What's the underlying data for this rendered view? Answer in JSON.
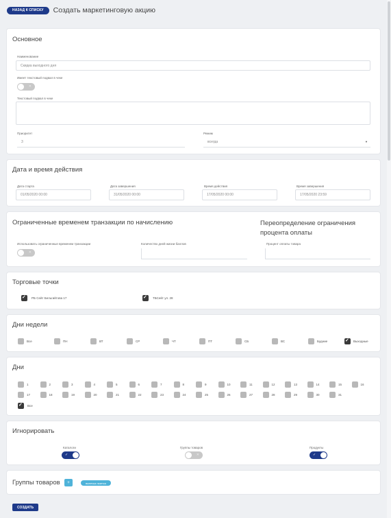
{
  "header": {
    "back_label": "НАЗАД К СПИСКУ",
    "title": "Создать маркетинговую акцию"
  },
  "basic": {
    "title": "Основное",
    "name_label": "Наименование",
    "name_placeholder": "Скидка выходного дня",
    "has_text_label": "Имеет текстовый подвал в чеке",
    "has_text_on": false,
    "footer_label": "Текстовый подвал в чеке",
    "footer_value": "",
    "priority_label": "Приоритет",
    "priority_value": "3",
    "mode_label": "Режим",
    "mode_value": "всегда"
  },
  "datetime": {
    "title": "Дата и время действия",
    "fields": [
      {
        "label": "Дата старта",
        "value": "01/05/2020 00:00"
      },
      {
        "label": "Дата завершения",
        "value": "31/05/2020 00:00"
      },
      {
        "label": "Время действия",
        "value": "17/05/2020 00:00"
      },
      {
        "label": "Время завершения",
        "value": "17/05/2020 23:59"
      }
    ]
  },
  "limits": {
    "title": "Ограниченные временем транзакции по начислению",
    "use_label": "Использовать ограниченные временем транзакции",
    "use_on": false,
    "days_label": "Количество дней жизни баллов",
    "days_value": "",
    "override_title": "Переопределение ограничения процента оплаты",
    "percent_label": "Процент оплаты товара",
    "percent_value": ""
  },
  "stores": {
    "title": "Торговые точки",
    "items": [
      {
        "label": "РБ Сейт Бельгийтова 17",
        "checked": true
      },
      {
        "label": "ТБСейт ул. 28",
        "checked": true
      }
    ]
  },
  "weekdays": {
    "title": "Дни недели",
    "items": [
      {
        "label": "Все",
        "checked": false
      },
      {
        "label": "ПН",
        "checked": false
      },
      {
        "label": "ВТ",
        "checked": false
      },
      {
        "label": "СР",
        "checked": false
      },
      {
        "label": "ЧТ",
        "checked": false
      },
      {
        "label": "ПТ",
        "checked": false
      },
      {
        "label": "СБ",
        "checked": false
      },
      {
        "label": "ВС",
        "checked": false
      },
      {
        "label": "Будние",
        "checked": false
      },
      {
        "label": "Выходные",
        "checked": true
      }
    ]
  },
  "days": {
    "title": "Дни",
    "numbers": [
      "1",
      "2",
      "3",
      "4",
      "5",
      "6",
      "7",
      "8",
      "9",
      "10",
      "11",
      "12",
      "13",
      "14",
      "15",
      "16",
      "17",
      "18",
      "19",
      "20",
      "21",
      "22",
      "23",
      "24",
      "25",
      "26",
      "27",
      "28",
      "29",
      "30",
      "31"
    ],
    "all_label": "Все",
    "all_checked": true
  },
  "ignore": {
    "title": "Игнорировать",
    "items": [
      {
        "label": "Каталоги",
        "on": true
      },
      {
        "label": "Группы товаров",
        "on": false
      },
      {
        "label": "Продукты",
        "on": true
      }
    ]
  },
  "groups": {
    "title": "Группы товаров",
    "add_icon": "+",
    "pill_label": "выпечка газетка"
  },
  "footer": {
    "create_label": "СОЗДАТЬ"
  },
  "icons": {
    "check": "✓",
    "cross": "✕",
    "arrow_down": "▼"
  }
}
